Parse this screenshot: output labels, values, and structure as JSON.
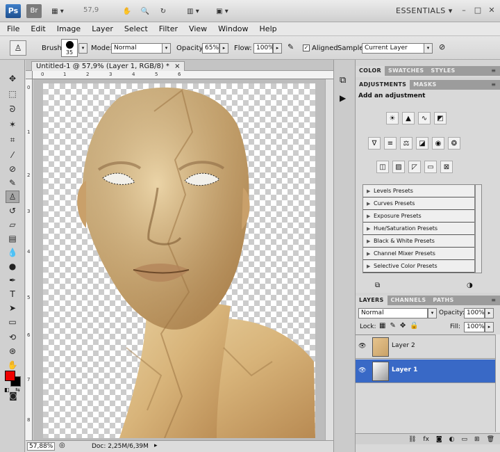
{
  "appbar": {
    "ps": "Ps",
    "br": "Br",
    "zoom": "57,9",
    "workspace": "ESSENTIALS"
  },
  "menu": [
    "File",
    "Edit",
    "Image",
    "Layer",
    "Select",
    "Filter",
    "View",
    "Window",
    "Help"
  ],
  "options": {
    "brush_label": "Brush:",
    "brush_size": "35",
    "mode_label": "Mode:",
    "mode_value": "Normal",
    "opacity_label": "Opacity:",
    "opacity_value": "65%",
    "flow_label": "Flow:",
    "flow_value": "100%",
    "aligned_label": "Aligned",
    "aligned_checked": "✓",
    "sample_label": "Sample:",
    "sample_value": "Current Layer"
  },
  "document": {
    "tab_title": "Untitled-1 @ 57,9% (Layer 1, RGB/8) *",
    "ruler_h": [
      "0",
      "1",
      "2",
      "3",
      "4",
      "5",
      "6"
    ],
    "ruler_v": [
      "0",
      "1",
      "2",
      "3",
      "4",
      "5",
      "6",
      "7",
      "8"
    ],
    "status_zoom": "57,88%",
    "status_doc": "Doc: 2,25M/6,39M"
  },
  "panels": {
    "top_tabs": [
      "COLOR",
      "SWATCHES",
      "STYLES"
    ],
    "adj_tabs": [
      "ADJUSTMENTS",
      "MASKS"
    ],
    "adj_heading": "Add an adjustment",
    "presets": [
      "Levels Presets",
      "Curves Presets",
      "Exposure Presets",
      "Hue/Saturation Presets",
      "Black & White Presets",
      "Channel Mixer Presets",
      "Selective Color Presets"
    ],
    "layer_tabs": [
      "LAYERS",
      "CHANNELS",
      "PATHS"
    ],
    "blend_mode": "Normal",
    "opacity_label": "Opacity:",
    "opacity_value": "100%",
    "lock_label": "Lock:",
    "fill_label": "Fill:",
    "fill_value": "100%",
    "layers": [
      {
        "name": "Layer 2",
        "selected": false
      },
      {
        "name": "Layer 1",
        "selected": true
      }
    ]
  },
  "colors": {
    "foreground": "#ee0000",
    "background": "#000000",
    "selection": "#3969c6"
  }
}
